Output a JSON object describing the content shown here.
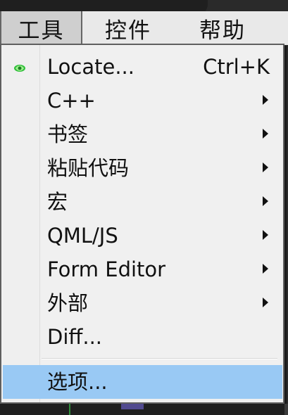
{
  "menubar": {
    "items": [
      {
        "label": "工具",
        "active": true
      },
      {
        "label": "控件",
        "active": false
      },
      {
        "label": "帮助",
        "active": false
      }
    ]
  },
  "menu": {
    "items": [
      {
        "label": "Locate...",
        "shortcut": "Ctrl+K",
        "icon": "locate-icon",
        "submenu": false,
        "selected": false
      },
      {
        "label": "C++",
        "submenu": true,
        "selected": false
      },
      {
        "label": "书签",
        "submenu": true,
        "selected": false
      },
      {
        "label": "粘贴代码",
        "submenu": true,
        "selected": false
      },
      {
        "label": "宏",
        "submenu": true,
        "selected": false
      },
      {
        "label": "QML/JS",
        "submenu": true,
        "selected": false
      },
      {
        "label": "Form Editor",
        "submenu": true,
        "selected": false
      },
      {
        "label": "外部",
        "submenu": true,
        "selected": false
      },
      {
        "label": "Diff...",
        "submenu": false,
        "selected": false
      },
      {
        "label": "选项...",
        "submenu": false,
        "selected": true
      }
    ]
  },
  "colors": {
    "menubar_bg": "#e9e9e9",
    "menu_bg": "#f0f0f0",
    "selected_bg": "#99c9f4",
    "border": "#5f5f5f",
    "icon_green": "#2fbf3a"
  }
}
